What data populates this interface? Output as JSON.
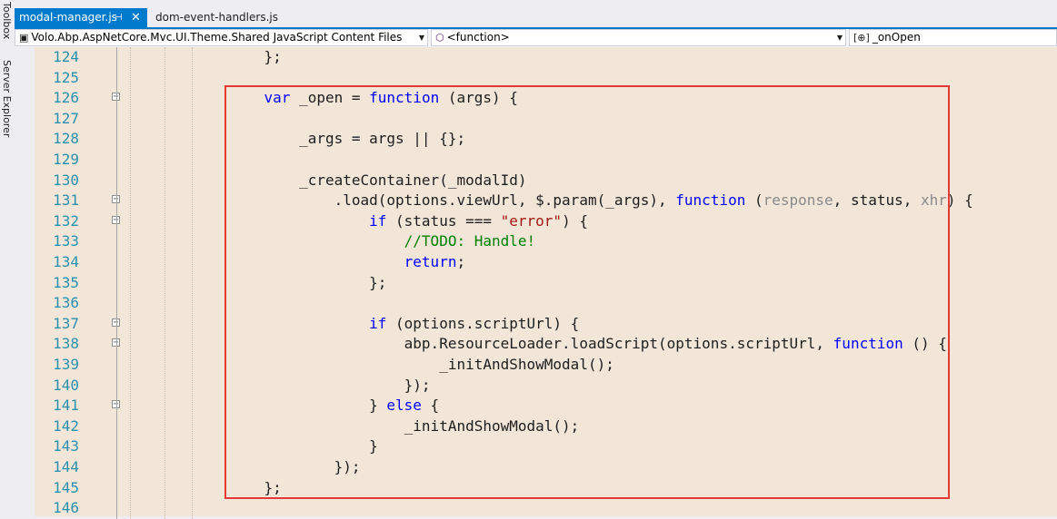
{
  "side_panels": [
    "Toolbox",
    "Server Explorer"
  ],
  "tabs": [
    {
      "label": "modal-manager.js",
      "pin": "⊣",
      "close": "✕"
    },
    {
      "label": "dom-event-handlers.js"
    }
  ],
  "nav": {
    "project": "Volo.Abp.AspNetCore.Mvc.UI.Theme.Shared JavaScript Content Files",
    "scope": "<function>",
    "member": "_onOpen"
  },
  "code_lines": [
    {
      "n": "124",
      "fold": false,
      "html": "    };"
    },
    {
      "n": "125",
      "fold": false,
      "html": ""
    },
    {
      "n": "126",
      "fold": true,
      "html": "    <span class=\"kw\">var</span> _open = <span class=\"kw\">function</span> (args) {"
    },
    {
      "n": "127",
      "fold": false,
      "html": ""
    },
    {
      "n": "128",
      "fold": false,
      "html": "        _args = args || {};"
    },
    {
      "n": "129",
      "fold": false,
      "html": ""
    },
    {
      "n": "130",
      "fold": false,
      "html": "        _createContainer(_modalId)"
    },
    {
      "n": "131",
      "fold": true,
      "html": "            .load(options.viewUrl, $.param(_args), <span class=\"kw\">function</span> (<span class=\"gray\">response</span>, status, <span class=\"gray\">xhr</span>) {"
    },
    {
      "n": "132",
      "fold": true,
      "html": "                <span class=\"kw\">if</span> (status === <span class=\"str\">\"error\"</span>) {"
    },
    {
      "n": "133",
      "fold": false,
      "html": "                    <span class=\"cmt\">//TODO: Handle!</span>"
    },
    {
      "n": "134",
      "fold": false,
      "html": "                    <span class=\"kw\">return</span>;"
    },
    {
      "n": "135",
      "fold": false,
      "html": "                };"
    },
    {
      "n": "136",
      "fold": false,
      "html": ""
    },
    {
      "n": "137",
      "fold": true,
      "html": "                <span class=\"kw\">if</span> (options.scriptUrl) {"
    },
    {
      "n": "138",
      "fold": true,
      "html": "                    abp.ResourceLoader.loadScript(options.scriptUrl, <span class=\"kw\">function</span> () {"
    },
    {
      "n": "139",
      "fold": false,
      "html": "                        _initAndShowModal();"
    },
    {
      "n": "140",
      "fold": false,
      "html": "                    });"
    },
    {
      "n": "141",
      "fold": true,
      "html": "                } <span class=\"kw\">else</span> {"
    },
    {
      "n": "142",
      "fold": false,
      "html": "                    _initAndShowModal();"
    },
    {
      "n": "143",
      "fold": false,
      "html": "                }"
    },
    {
      "n": "144",
      "fold": false,
      "html": "            });"
    },
    {
      "n": "145",
      "fold": false,
      "html": "    };"
    },
    {
      "n": "146",
      "fold": false,
      "html": ""
    }
  ],
  "colors": {
    "accent": "#007acc",
    "editor_bg": "#f2e6d9",
    "highlight_box": "#e53935",
    "keyword": "#0000ff",
    "string": "#a31515",
    "comment": "#008000",
    "line_number": "#2b91af"
  }
}
